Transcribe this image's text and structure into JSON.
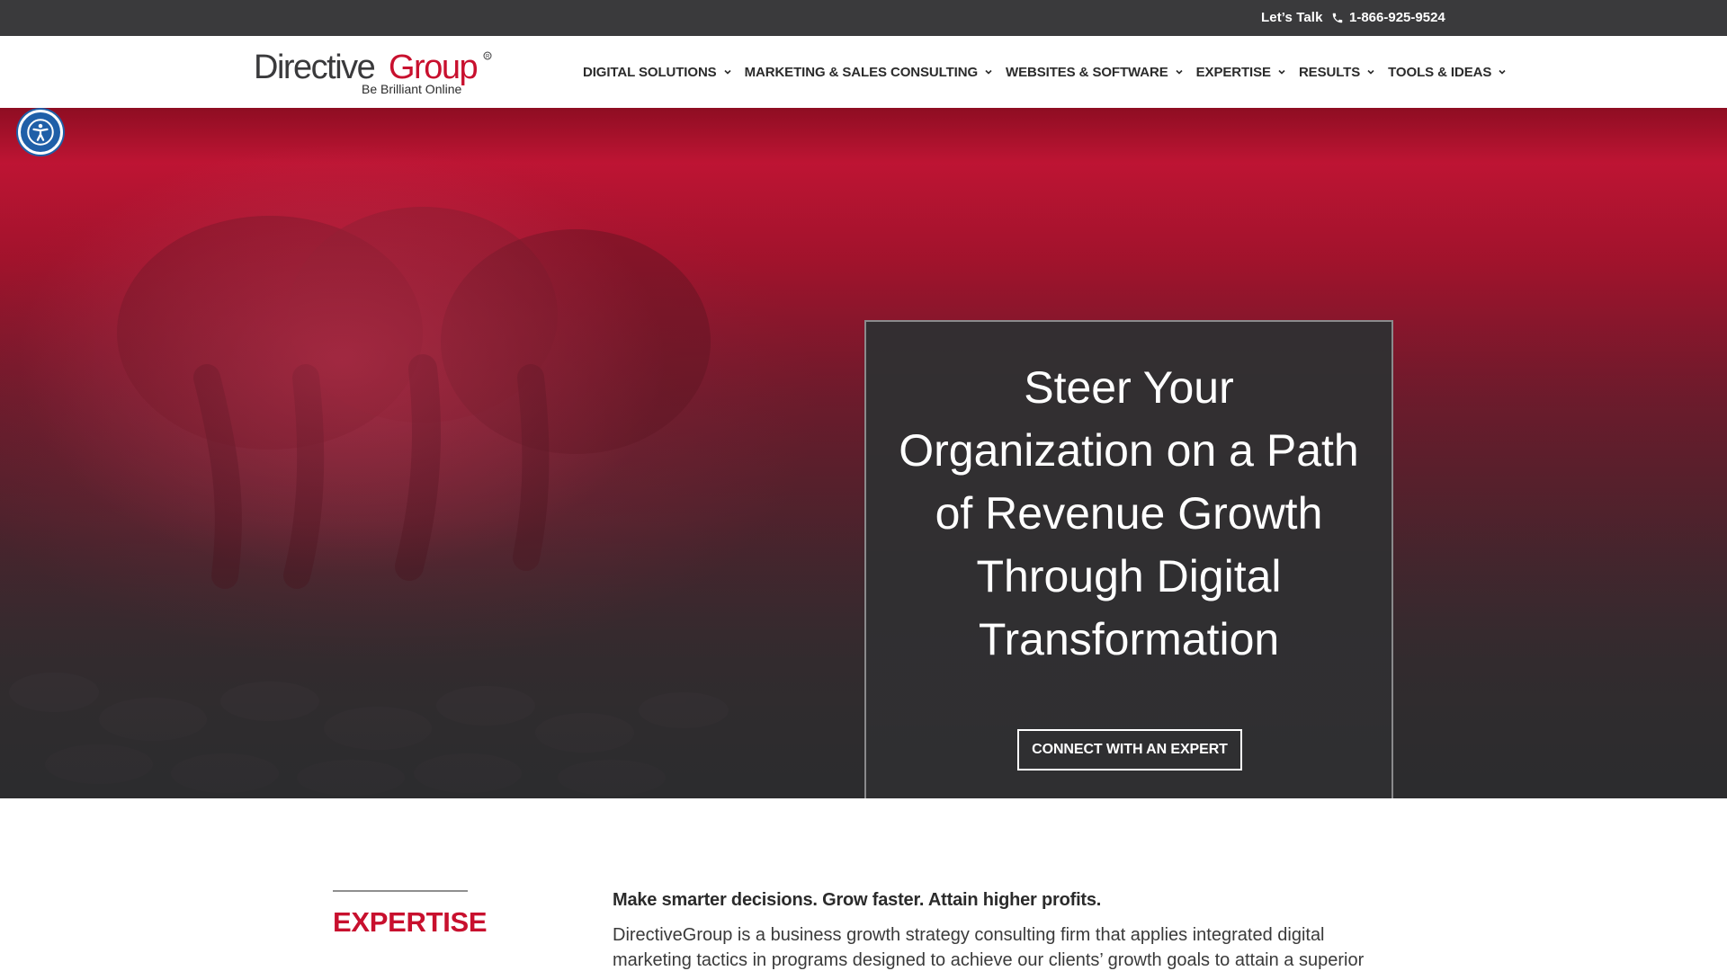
{
  "topbar": {
    "lets_talk": "Let’s Talk",
    "phone": "1-866-925-9524"
  },
  "brand": {
    "logo_main": "DirectiveGroup",
    "logo_word1": "Directive",
    "logo_word2": "Group",
    "logo_tagline": "Be Brilliant Online",
    "accent_color": "#c8102e",
    "dark_color": "#3a3a3c"
  },
  "nav": {
    "items": [
      {
        "label": "DIGITAL SOLUTIONS",
        "icon": "chevron-down-icon"
      },
      {
        "label": "MARKETING & SALES CONSULTING",
        "icon": "chevron-down-icon"
      },
      {
        "label": "WEBSITES & SOFTWARE",
        "icon": "chevron-down-icon"
      },
      {
        "label": "EXPERTISE",
        "icon": "chevron-down-icon"
      },
      {
        "label": "RESULTS",
        "icon": "chevron-down-icon"
      },
      {
        "label": "TOOLS & IDEAS",
        "icon": "chevron-down-icon"
      }
    ]
  },
  "accessibility": {
    "icon": "accessibility-icon"
  },
  "hero": {
    "title": "Steer Your Organization on a Path of Revenue Growth Through Digital Transformation",
    "cta_label": "CONNECT WITH AN EXPERT"
  },
  "expertise": {
    "heading": "EXPERTISE",
    "lead": "Make smarter decisions. Grow faster. Attain higher profits.",
    "body": "DirectiveGroup is a business growth strategy consulting firm that applies integrated digital marketing tactics in programs designed to achieve our clients’ growth goals to attain a superior ROI."
  }
}
